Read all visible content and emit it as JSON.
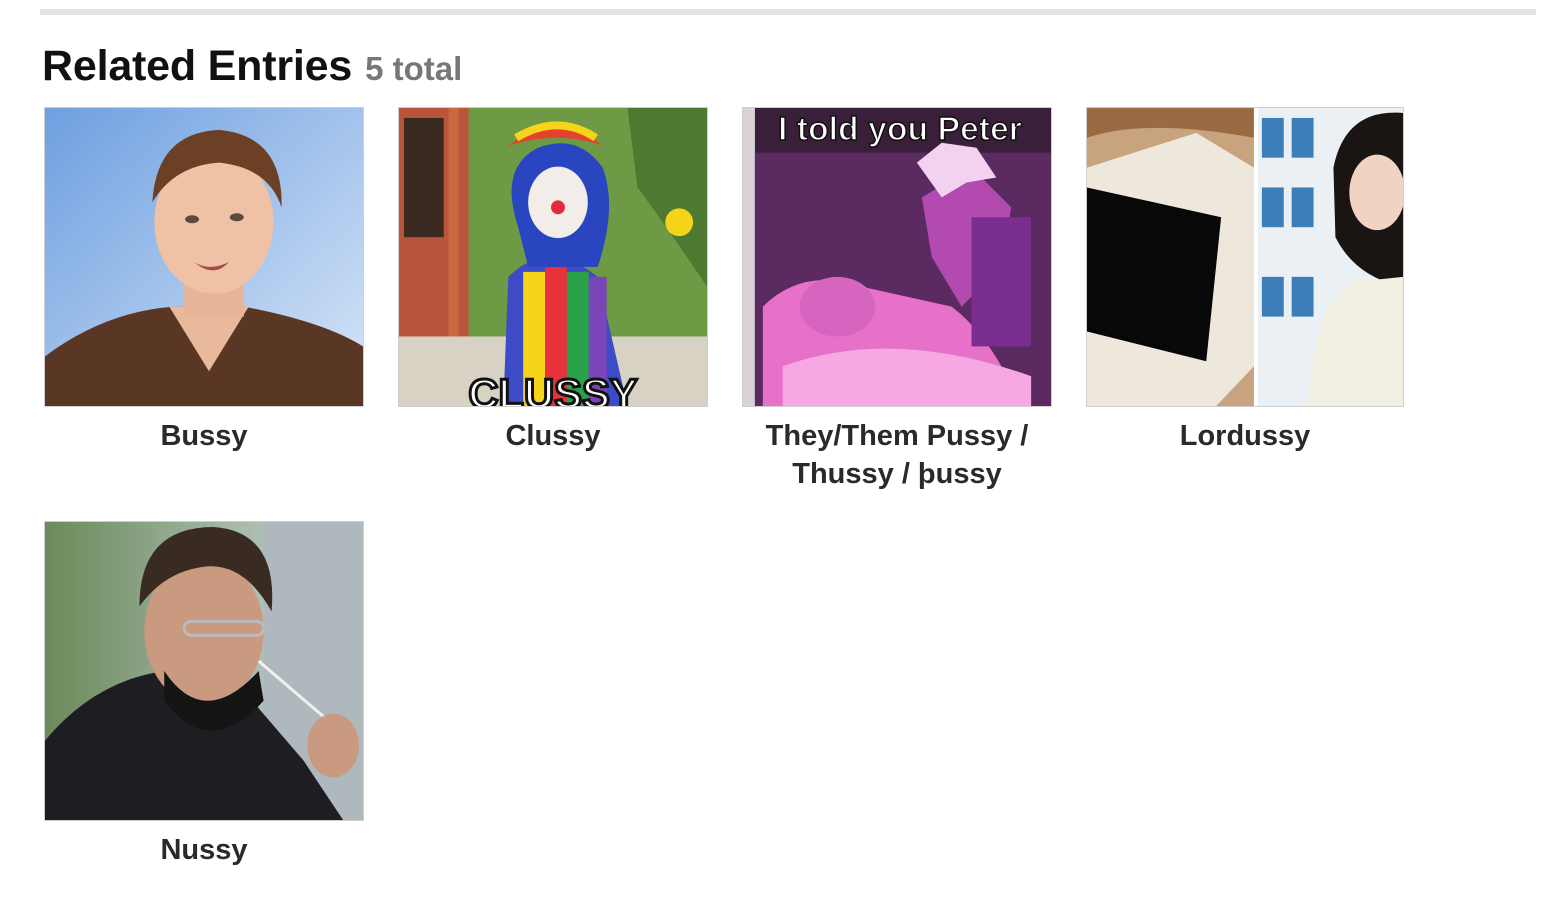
{
  "section": {
    "title": "Related Entries",
    "count": "5 total"
  },
  "entries": [
    {
      "title": "Bussy",
      "image_icon": "portrait-photo"
    },
    {
      "title": "Clussy",
      "image_icon": "clown-costume-photo",
      "image_caption": "CLUSSY"
    },
    {
      "title": "They/Them Pussy / Thussy / þussy",
      "image_icon": "meme-image",
      "image_caption": "I told you Peter"
    },
    {
      "title": "Lordussy",
      "image_icon": "split-photo"
    },
    {
      "title": "Nussy",
      "image_icon": "portrait-photo"
    }
  ],
  "colors": {
    "heading": "#111111",
    "count": "#777777",
    "entry_title": "#2a2a2a",
    "rule": "#e2e2e2"
  }
}
